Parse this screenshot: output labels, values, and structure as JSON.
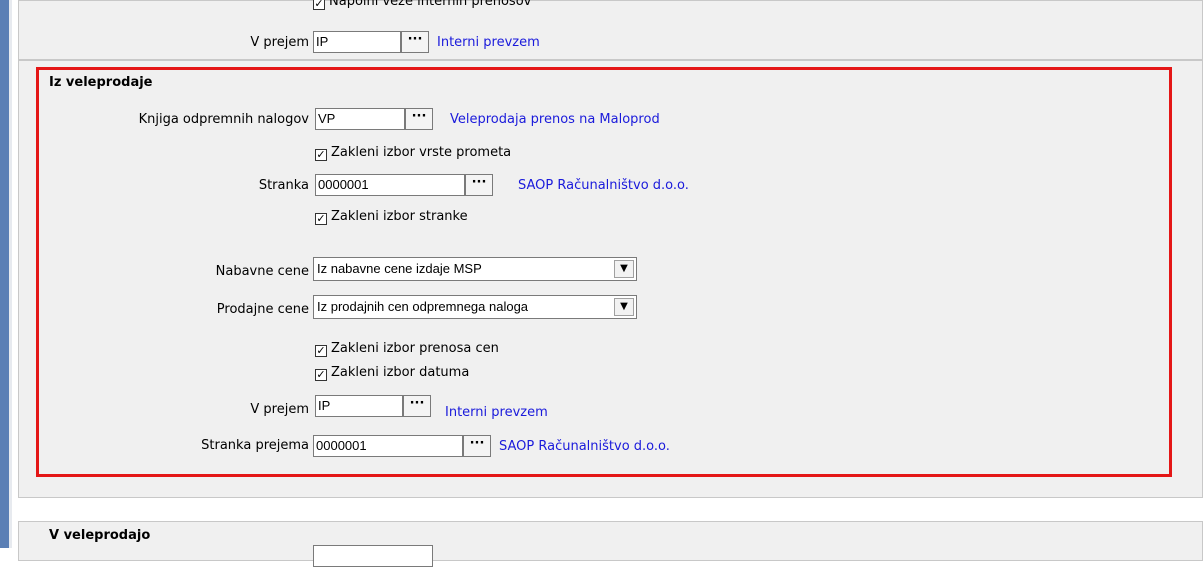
{
  "top_section": {
    "cut_checkbox_label": "Napolni veze internih prenosov",
    "v_prejem": {
      "label": "V prejem",
      "value": "IP",
      "lookup_text": "Interni prevzem"
    }
  },
  "iz_veleprodaje": {
    "title": "Iz veleprodaje",
    "knjiga": {
      "label": "Knjiga odpremnih nalogov",
      "value": "VP",
      "lookup_text": "Veleprodaja prenos na Maloprod"
    },
    "zakleni_vrste_prometa": {
      "label": "Zakleni izbor vrste prometa",
      "checked": true
    },
    "stranka": {
      "label": "Stranka",
      "value": "0000001",
      "lookup_text": "SAOP Računalništvo d.o.o."
    },
    "zakleni_stranke": {
      "label": "Zakleni izbor stranke",
      "checked": true
    },
    "nabavne_cene": {
      "label": "Nabavne cene",
      "selected": "Iz nabavne cene izdaje MSP"
    },
    "prodajne_cene": {
      "label": "Prodajne cene",
      "selected": "Iz prodajnih cen odpremnega naloga"
    },
    "zakleni_prenosa_cen": {
      "label": "Zakleni izbor prenosa cen",
      "checked": true
    },
    "zakleni_datuma": {
      "label": "Zakleni izbor datuma",
      "checked": true
    },
    "v_prejem": {
      "label": "V prejem",
      "value": "IP",
      "lookup_text": "Interni prevzem"
    },
    "stranka_prejema": {
      "label": "Stranka prejema",
      "value": "0000001",
      "lookup_text": "SAOP Računalništvo d.o.o."
    }
  },
  "v_veleprodajo": {
    "title": "V veleprodajo"
  },
  "ui": {
    "lookup_button": "···",
    "check_mark": "✓",
    "dropdown_arrow": "▼"
  },
  "colors": {
    "highlight": "#e41616",
    "link": "#1a1adb",
    "panel_bg": "#f0f0f0",
    "left_bar": "#5b7fb5"
  }
}
